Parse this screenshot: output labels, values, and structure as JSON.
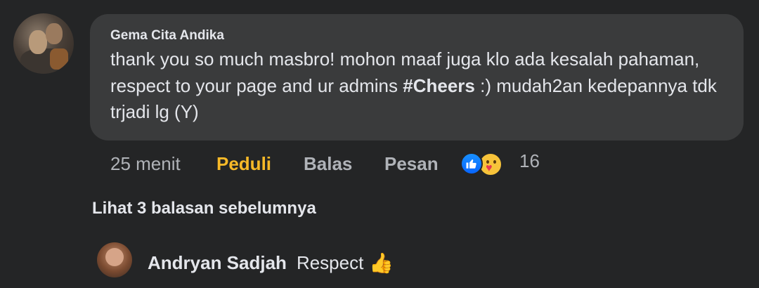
{
  "comment": {
    "author": "Gema Cita Andika",
    "text_before": "thank you so much masbro! mohon maaf juga klo ada kesalah pahaman, respect to your page and ur admins ",
    "hashtag": "#Cheers",
    "text_after": " :) mudah2an kedepannya tdk trjadi lg (Y)",
    "time": "25 menit",
    "actions": {
      "like": "Peduli",
      "reply": "Balas",
      "message": "Pesan"
    },
    "reaction_count": "16",
    "reaction_icons": [
      "like-icon",
      "care-icon"
    ]
  },
  "thread": {
    "view_previous": "Lihat 3 balasan sebelumnya"
  },
  "reply": {
    "author": "Andryan Sadjah",
    "text": "Respect",
    "emoji": "👍"
  },
  "colors": {
    "background": "#242526",
    "bubble": "#3a3b3c",
    "primary_text": "#e4e6eb",
    "secondary_text": "#b0b3b8",
    "care_active": "#f7b928",
    "like_blue": "#0866ff"
  }
}
